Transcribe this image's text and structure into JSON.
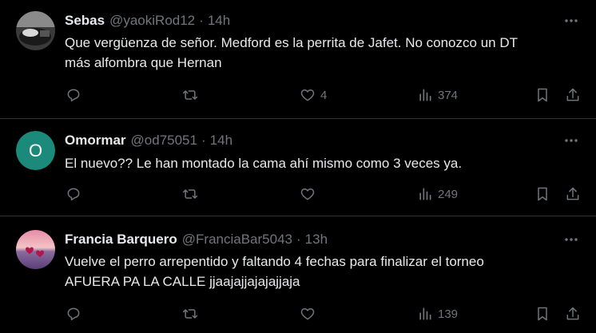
{
  "tweets": [
    {
      "name": "Sebas",
      "handle": "@yaokiRod12",
      "time": "14h",
      "text": "Que vergüenza de señor. Medford es la perrita de Jafet. No conozco un DT\nmás alfombra que Hernan",
      "likes": "4",
      "views": "374",
      "avatar_style": "photo-dark"
    },
    {
      "name": "Omormar",
      "handle": "@od75051",
      "time": "14h",
      "text": "El nuevo??  Le han montado la cama ahí mismo como 3 veces ya.",
      "likes": "",
      "views": "249",
      "avatar_letter": "O",
      "avatar_color": "#1b8a7a"
    },
    {
      "name": "Francia Barquero",
      "handle": "@FranciaBar5043",
      "time": "13h",
      "text": "Vuelve el perro arrepentido y faltando 4 fechas para finalizar el torneo\nAFUERA PA LA CALLE jjaajajjajajajjaja",
      "likes": "",
      "views": "139",
      "avatar_style": "sunset-hearts"
    }
  ],
  "separator": "·",
  "icons": {
    "reply": "reply-icon",
    "retweet": "retweet-icon",
    "like": "heart-icon",
    "views": "views-icon",
    "bookmark": "bookmark-icon",
    "share": "share-icon",
    "more": "more-icon"
  },
  "colors": {
    "background": "#000000",
    "text": "#e7e9ea",
    "muted": "#71767b",
    "divider": "#2f3336"
  }
}
